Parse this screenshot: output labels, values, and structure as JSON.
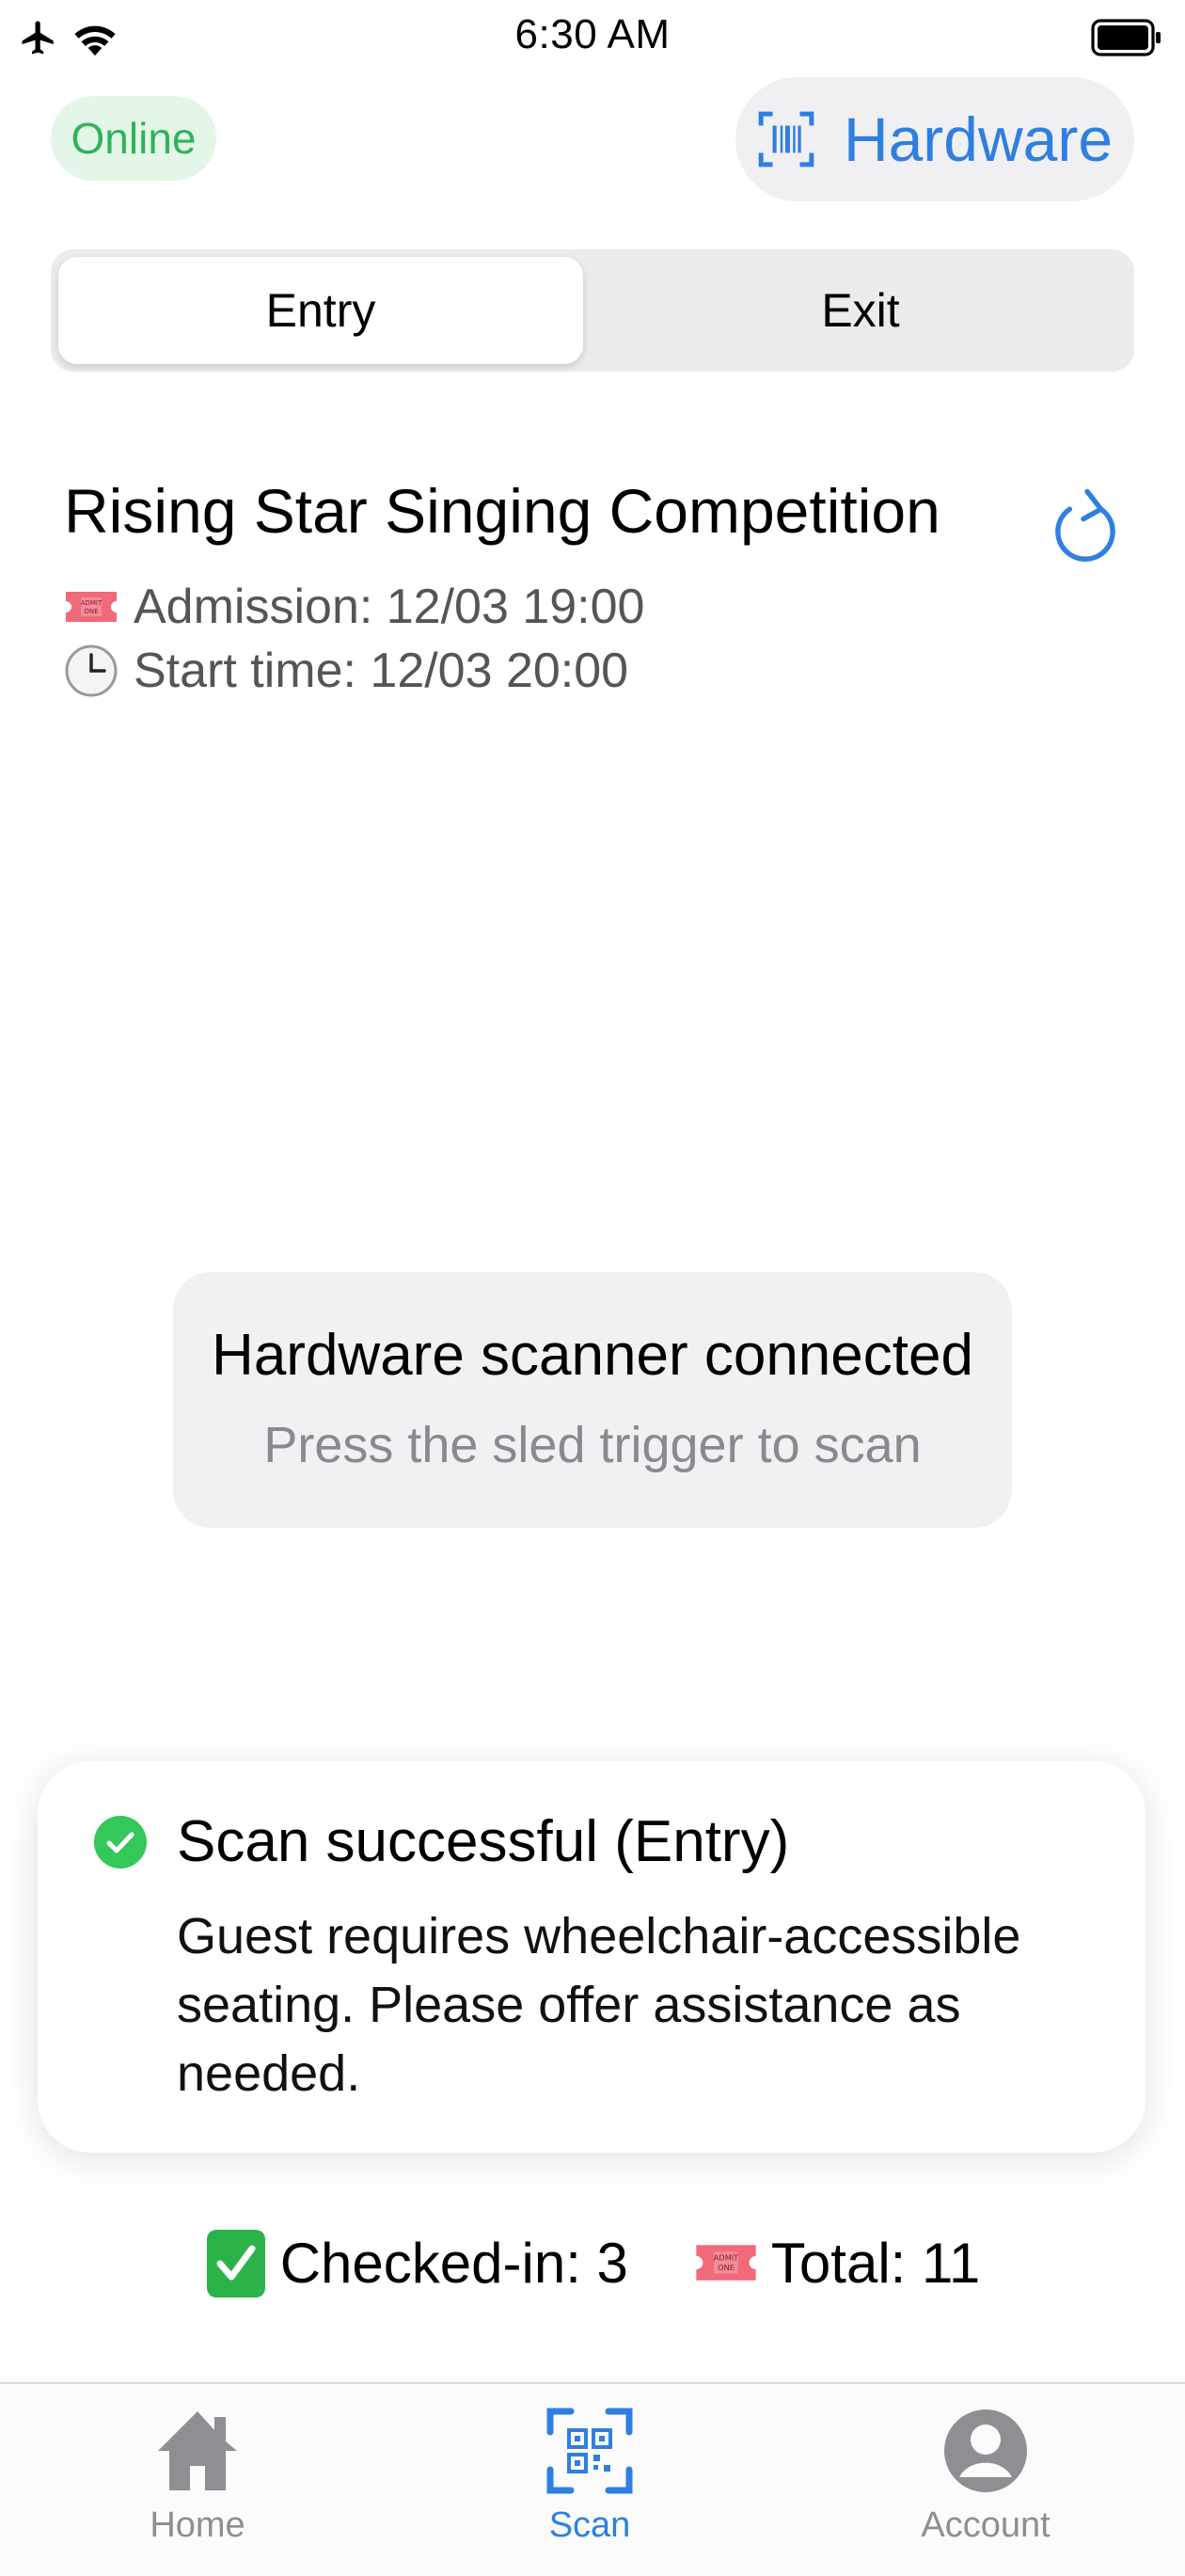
{
  "status_bar": {
    "time": "6:30 AM",
    "icons": [
      "airplane-icon",
      "wifi-icon",
      "battery-icon"
    ]
  },
  "header": {
    "online_label": "Online",
    "hardware_label": "Hardware",
    "hardware_icon": "barcode-scanner-icon"
  },
  "mode_switch": {
    "entry_label": "Entry",
    "exit_label": "Exit",
    "selected": "Entry"
  },
  "event": {
    "title": "Rising Star Singing Competition",
    "admission": "Admission: 12/03 19:00",
    "start_time": "Start time: 12/03 20:00",
    "refresh_icon": "refresh-icon"
  },
  "scanner": {
    "title": "Hardware scanner connected",
    "subtitle": "Press the sled trigger to scan"
  },
  "toast": {
    "title": "Scan successful (Entry)",
    "message": "Guest requires wheelchair-accessible seating. Please offer assistance as needed.",
    "icon": "check-circle-icon"
  },
  "stats": {
    "checked_in": "Checked-in: 3",
    "total": "Total: 11"
  },
  "tabbar": {
    "items": [
      {
        "label": "Home",
        "icon": "home-icon"
      },
      {
        "label": "Scan",
        "icon": "qr-scan-icon",
        "active": true
      },
      {
        "label": "Account",
        "icon": "account-icon"
      }
    ]
  },
  "colors": {
    "accent": "#2f7fe0",
    "online": "#2fb35a",
    "online_bg": "#e3f6e7",
    "success": "#34c759",
    "ticket": "#f06a7a"
  }
}
